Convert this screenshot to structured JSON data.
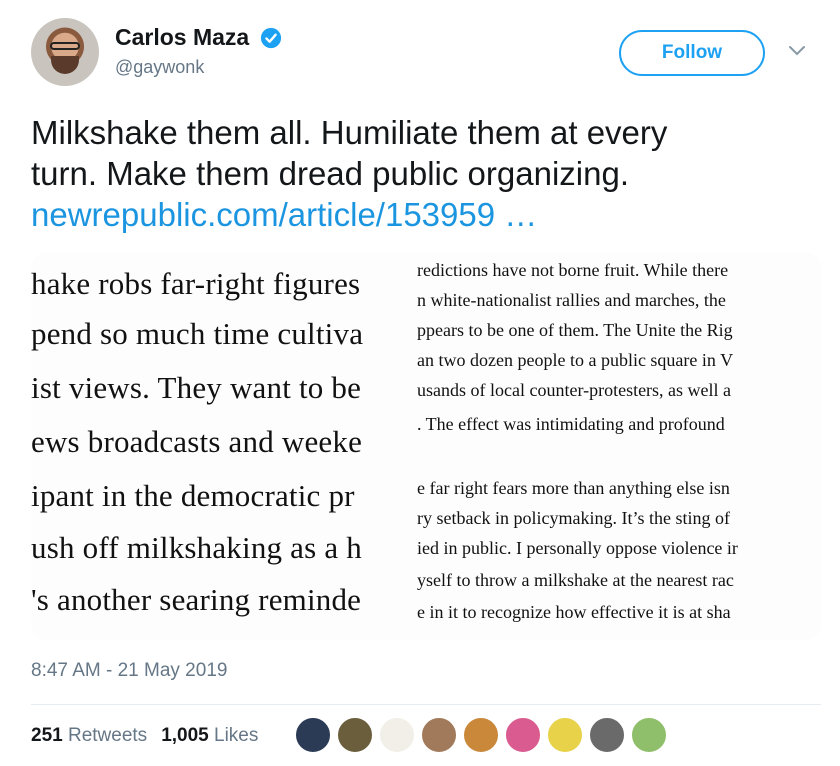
{
  "user": {
    "display_name": "Carlos Maza",
    "handle": "@gaywonk",
    "verified": true
  },
  "follow_label": "Follow",
  "tweet": {
    "line1": "Milkshake them all. Humiliate them at every",
    "line2": "turn. Make them dread public organizing.",
    "link": "newrepublic.com/article/153959 …"
  },
  "article_image": {
    "left_lines": [
      "hake robs far-right figures",
      "pend so much time cultiva",
      "ist views. They want to be",
      "ews broadcasts and weeke",
      "ipant in the democratic pr",
      "ush off milkshaking as a h",
      "'s another searing reminde"
    ],
    "right_lines": [
      "redictions have not borne fruit. While there",
      "n white-nationalist rallies and marches, the",
      "ppears to be one of them. The Unite the Rig",
      "an two dozen people to a public square in V",
      "usands of local counter-protesters, as well a",
      ". The effect was intimidating and profound",
      "e far right fears more than anything else isn",
      "ry setback in policymaking. It’s the sting of",
      "ied in public. I personally oppose violence ir",
      "yself to throw a milkshake at the nearest rac",
      "e in it to recognize how effective it is at sha"
    ]
  },
  "timestamp": "8:47 AM - 21 May 2019",
  "stats": {
    "retweets_count": "251",
    "retweets_label": "Retweets",
    "likes_count": "1,005",
    "likes_label": "Likes"
  },
  "liker_avatar_colors": [
    "#2b3a55",
    "#6b5e3c",
    "#f2efe8",
    "#a07a5a",
    "#c9883a",
    "#d95b8f",
    "#e8d24a",
    "#6a6a6a",
    "#8fbf6a"
  ],
  "colors": {
    "accent": "#1da1f2",
    "link": "#1b95e0",
    "secondary_text": "#657786"
  }
}
